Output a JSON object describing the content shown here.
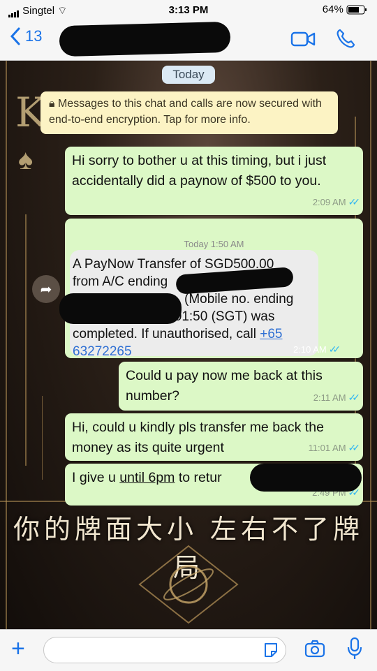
{
  "status_bar": {
    "carrier": "Singtel",
    "time": "3:13 PM",
    "battery": "64%"
  },
  "header": {
    "back_count": "13",
    "contact_name_redacted": true
  },
  "chat": {
    "date_chip": "Today",
    "encryption_notice": "Messages to this chat and calls are now secured with end-to-end encryption. Tap for more info.",
    "messages": [
      {
        "text": "Hi sorry to bother u at this timing, but i just accidentally did a paynow of $500 to you.",
        "time": "2:09 AM"
      },
      {
        "forwarded_date": "Today 1:50 AM",
        "line1": "A PayNow Transfer of SGD500.00",
        "line2": "from A/C ending",
        "line3": "(Mobile no. ending",
        "line4": "8203) on 23 Nov 01:50 (SGT) was",
        "line5_prefix": "completed. If unauthorised, call ",
        "phone": "+65 63272265",
        "time": "2:10 AM"
      },
      {
        "text": "Could u pay now me back at this number?",
        "time": "2:11 AM"
      },
      {
        "text": "Hi, could u kindly pls transfer me back the money as its quite urgent",
        "time": "11:01 AM"
      },
      {
        "text_prefix": "I give u ",
        "text_underlined": "until 6pm",
        "text_suffix": " to retur",
        "time": "2:49 PM"
      }
    ]
  },
  "wallpaper": {
    "chinese_text": "你的牌面大小  左右不了牌局",
    "letter": "K"
  },
  "colors": {
    "accent": "#1a73e8",
    "bubble": "#dcf8c6",
    "tick": "#34b7f1"
  }
}
